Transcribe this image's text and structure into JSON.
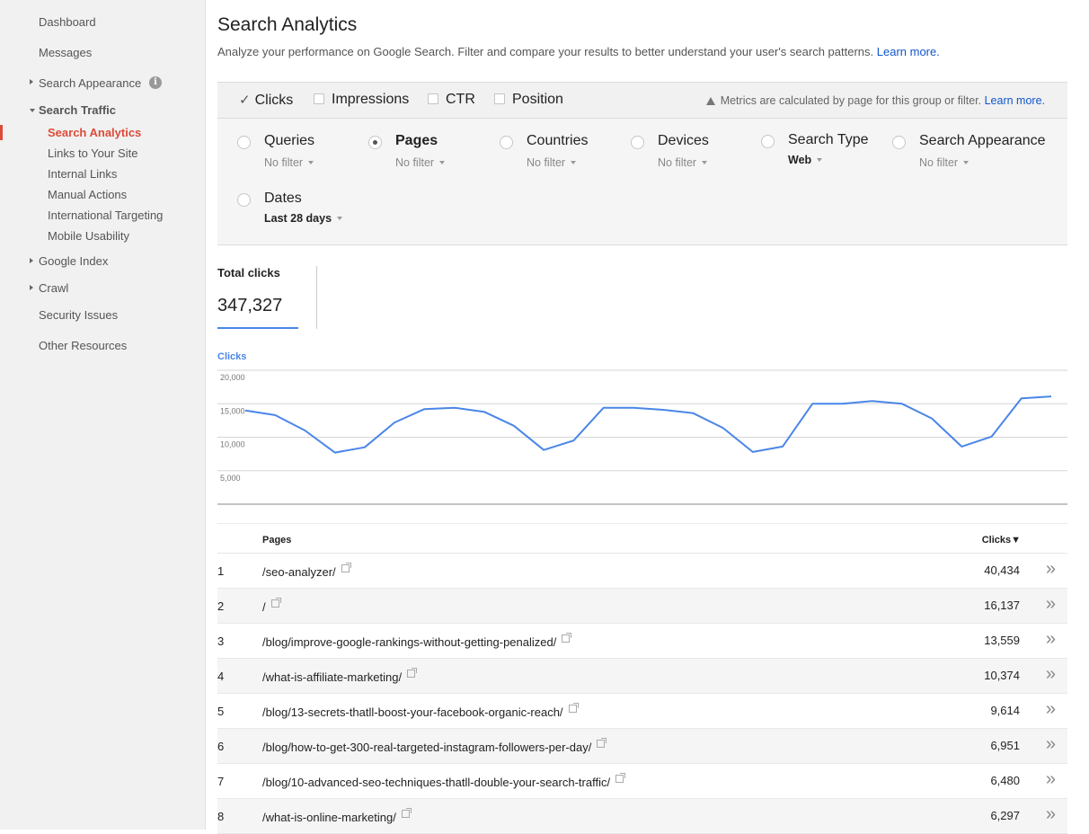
{
  "sidebar": {
    "items": [
      {
        "label": "Dashboard"
      },
      {
        "label": "Messages"
      },
      {
        "label": "Search Appearance",
        "expandable": true,
        "info_icon": "info-icon"
      },
      {
        "label": "Search Traffic",
        "expanded": true
      },
      {
        "label": "Search Analytics",
        "active": true
      },
      {
        "label": "Links to Your Site"
      },
      {
        "label": "Internal Links"
      },
      {
        "label": "Manual Actions"
      },
      {
        "label": "International Targeting"
      },
      {
        "label": "Mobile Usability"
      },
      {
        "label": "Google Index",
        "expandable": true
      },
      {
        "label": "Crawl",
        "expandable": true
      },
      {
        "label": "Security Issues"
      },
      {
        "label": "Other Resources"
      }
    ],
    "info_glyph": "i",
    "active_color": "#dd4b39"
  },
  "header": {
    "title": "Search Analytics",
    "description": "Analyze your performance on Google Search. Filter and compare your results to better understand your user's search patterns.",
    "learn_more": "Learn more."
  },
  "metrics": {
    "items": [
      {
        "label": "Clicks",
        "checked": true
      },
      {
        "label": "Impressions",
        "checked": false
      },
      {
        "label": "CTR",
        "checked": false
      },
      {
        "label": "Position",
        "checked": false
      }
    ],
    "check_glyph": "✓",
    "note": "Metrics are calculated by page for this group or filter.",
    "note_link": "Learn more."
  },
  "filters": [
    {
      "label": "Queries",
      "value": "No filter",
      "selected": false
    },
    {
      "label": "Pages",
      "value": "No filter",
      "selected": true
    },
    {
      "label": "Countries",
      "value": "No filter",
      "selected": false
    },
    {
      "label": "Devices",
      "value": "No filter",
      "selected": false
    },
    {
      "label": "Search Type",
      "value": "Web",
      "selected": false
    },
    {
      "label": "Search Appearance",
      "value": "No filter",
      "selected": false
    },
    {
      "label": "Dates",
      "value": "Last 28 days",
      "selected": false
    }
  ],
  "total": {
    "label": "Total clicks",
    "value": "347,327"
  },
  "chart_data": {
    "type": "line",
    "title": "Clicks",
    "xlabel": "",
    "ylabel": "Clicks",
    "ylim": [
      0,
      20000
    ],
    "yticks": [
      5000,
      10000,
      15000,
      20000
    ],
    "ytick_labels": [
      "5,000",
      "10,000",
      "15,000",
      "20,000"
    ],
    "grid": true,
    "color": "#4a86e8",
    "series": [
      {
        "name": "Clicks",
        "values": [
          14000,
          13300,
          11000,
          7700,
          8500,
          12200,
          14200,
          14400,
          13800,
          11700,
          8100,
          9500,
          14400,
          14400,
          14100,
          13600,
          11400,
          7800,
          8600,
          15000,
          15000,
          15400,
          15000,
          12800,
          8600,
          10100,
          15800,
          16100
        ]
      }
    ]
  },
  "table": {
    "headers": {
      "pages": "Pages",
      "clicks": "Clicks▼"
    },
    "more_glyph": "»",
    "rows": [
      {
        "rank": "1",
        "page": "/seo-analyzer/",
        "clicks": "40,434"
      },
      {
        "rank": "2",
        "page": "/",
        "clicks": "16,137"
      },
      {
        "rank": "3",
        "page": "/blog/improve-google-rankings-without-getting-penalized/",
        "clicks": "13,559"
      },
      {
        "rank": "4",
        "page": "/what-is-affiliate-marketing/",
        "clicks": "10,374"
      },
      {
        "rank": "5",
        "page": "/blog/13-secrets-thatll-boost-your-facebook-organic-reach/",
        "clicks": "9,614"
      },
      {
        "rank": "6",
        "page": "/blog/how-to-get-300-real-targeted-instagram-followers-per-day/",
        "clicks": "6,951"
      },
      {
        "rank": "7",
        "page": "/blog/10-advanced-seo-techniques-thatll-double-your-search-traffic/",
        "clicks": "6,480"
      },
      {
        "rank": "8",
        "page": "/what-is-online-marketing/",
        "clicks": "6,297"
      }
    ]
  }
}
